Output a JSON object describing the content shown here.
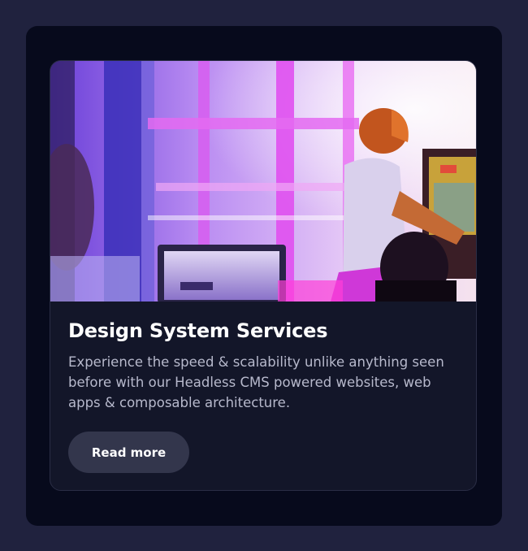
{
  "card": {
    "title": "Design System Services",
    "description": "Experience the speed & scalability unlike anything seen before with our Headless CMS powered websites, web apps & composable architecture.",
    "button_label": "Read more",
    "image_alt": "Person playing an arcade game in a neon-lit room"
  },
  "colors": {
    "page_background": "#20223e",
    "panel_background": "#070a1c",
    "card_background": "#131629",
    "button_background": "#33364c",
    "title": "#ffffff",
    "body_text": "#b7b9cc"
  }
}
